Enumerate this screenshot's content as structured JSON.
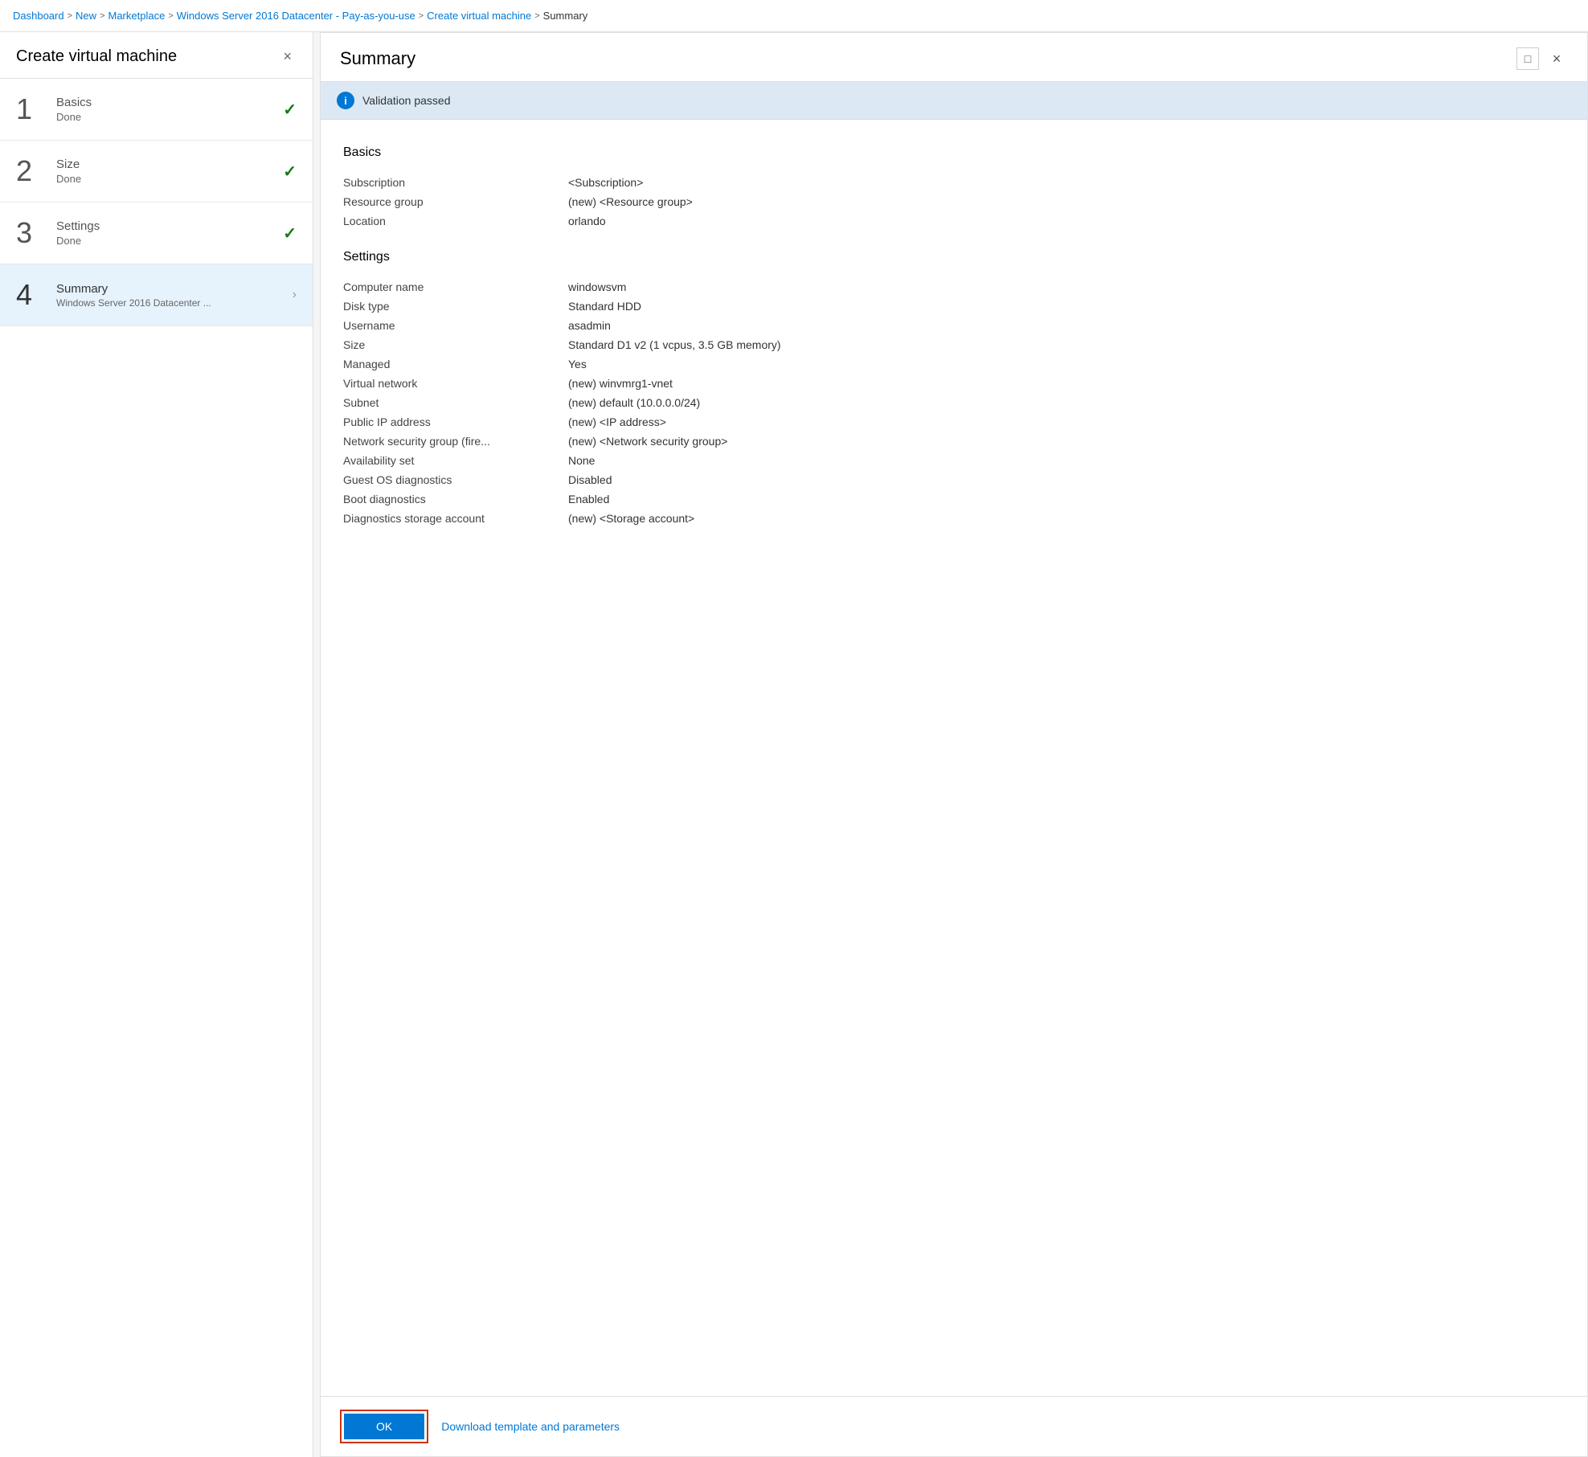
{
  "breadcrumb": {
    "items": [
      {
        "label": "Dashboard",
        "link": true
      },
      {
        "label": "New",
        "link": true
      },
      {
        "label": "Marketplace",
        "link": true
      },
      {
        "label": "Windows Server 2016 Datacenter - Pay-as-you-use",
        "link": true
      },
      {
        "label": "Create virtual machine",
        "link": true
      },
      {
        "label": "Summary",
        "link": false
      }
    ],
    "separator": ">"
  },
  "left_panel": {
    "title": "Create virtual machine",
    "close_label": "×",
    "steps": [
      {
        "number": "1",
        "name": "Basics",
        "status": "Done",
        "check": "✓",
        "active": false,
        "sub": null
      },
      {
        "number": "2",
        "name": "Size",
        "status": "Done",
        "check": "✓",
        "active": false,
        "sub": null
      },
      {
        "number": "3",
        "name": "Settings",
        "status": "Done",
        "check": "✓",
        "active": false,
        "sub": null
      },
      {
        "number": "4",
        "name": "Summary",
        "status": "Windows Server 2016 Datacenter ...",
        "check": null,
        "active": true,
        "sub": "Windows Server 2016 Datacenter ..."
      }
    ]
  },
  "right_panel": {
    "title": "Summary",
    "maximize_label": "□",
    "close_label": "×",
    "validation": {
      "text": "Validation passed"
    },
    "sections": [
      {
        "title": "Basics",
        "rows": [
          {
            "label": "Subscription",
            "value": "<Subscription>"
          },
          {
            "label": "Resource group",
            "value": "(new) <Resource group>"
          },
          {
            "label": "Location",
            "value": "orlando"
          }
        ]
      },
      {
        "title": "Settings",
        "rows": [
          {
            "label": "Computer name",
            "value": "windowsvm"
          },
          {
            "label": "Disk type",
            "value": "Standard HDD"
          },
          {
            "label": "Username",
            "value": "asadmin"
          },
          {
            "label": "Size",
            "value": "Standard D1 v2 (1 vcpus, 3.5 GB memory)"
          },
          {
            "label": "Managed",
            "value": "Yes"
          },
          {
            "label": "Virtual network",
            "value": "(new) winvmrg1-vnet"
          },
          {
            "label": "Subnet",
            "value": "(new) default (10.0.0.0/24)"
          },
          {
            "label": "Public IP address",
            "value": "(new) <IP address>"
          },
          {
            "label": "Network security group (fire...",
            "value": "(new) <Network security group>"
          },
          {
            "label": "Availability set",
            "value": "None"
          },
          {
            "label": "Guest OS diagnostics",
            "value": "Disabled"
          },
          {
            "label": "Boot diagnostics",
            "value": "Enabled"
          },
          {
            "label": "Diagnostics storage account",
            "value": "(new) <Storage account>"
          }
        ]
      }
    ],
    "ok_button_label": "OK",
    "download_link_label": "Download template and parameters"
  }
}
